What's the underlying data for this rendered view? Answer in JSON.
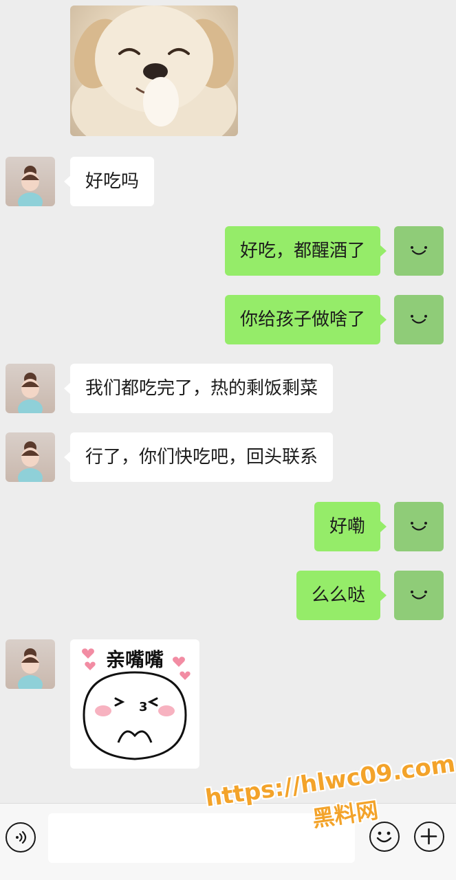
{
  "messages": [
    {
      "side": "left",
      "type": "sticker",
      "sticker": "puppy-laughing-sticker"
    },
    {
      "side": "left",
      "type": "text",
      "text": "好吃吗"
    },
    {
      "side": "right",
      "type": "text",
      "text": "好吃，都醒酒了"
    },
    {
      "side": "right",
      "type": "text",
      "text": "你给孩子做啥了"
    },
    {
      "side": "left",
      "type": "text",
      "text": "我们都吃完了，热的剩饭剩菜"
    },
    {
      "side": "left",
      "type": "text",
      "text": "行了，你们快吃吧，回头联系"
    },
    {
      "side": "right",
      "type": "text",
      "text": "好嘞"
    },
    {
      "side": "right",
      "type": "text",
      "text": "么么哒"
    },
    {
      "side": "left",
      "type": "sticker",
      "sticker": "kiss-bear-sticker",
      "caption": "亲嘴嘴"
    }
  ],
  "input_bar": {
    "placeholder": "",
    "icons": [
      "voice-icon",
      "emoji-icon",
      "plus-icon"
    ]
  },
  "watermark": {
    "url": "https://hlwc09.com",
    "name": "黑料网"
  },
  "colors": {
    "background": "#ededed",
    "sent_bubble": "#95ec69",
    "received_bubble": "#ffffff",
    "my_avatar": "#8fcc78",
    "watermark": "#f3a32a"
  }
}
